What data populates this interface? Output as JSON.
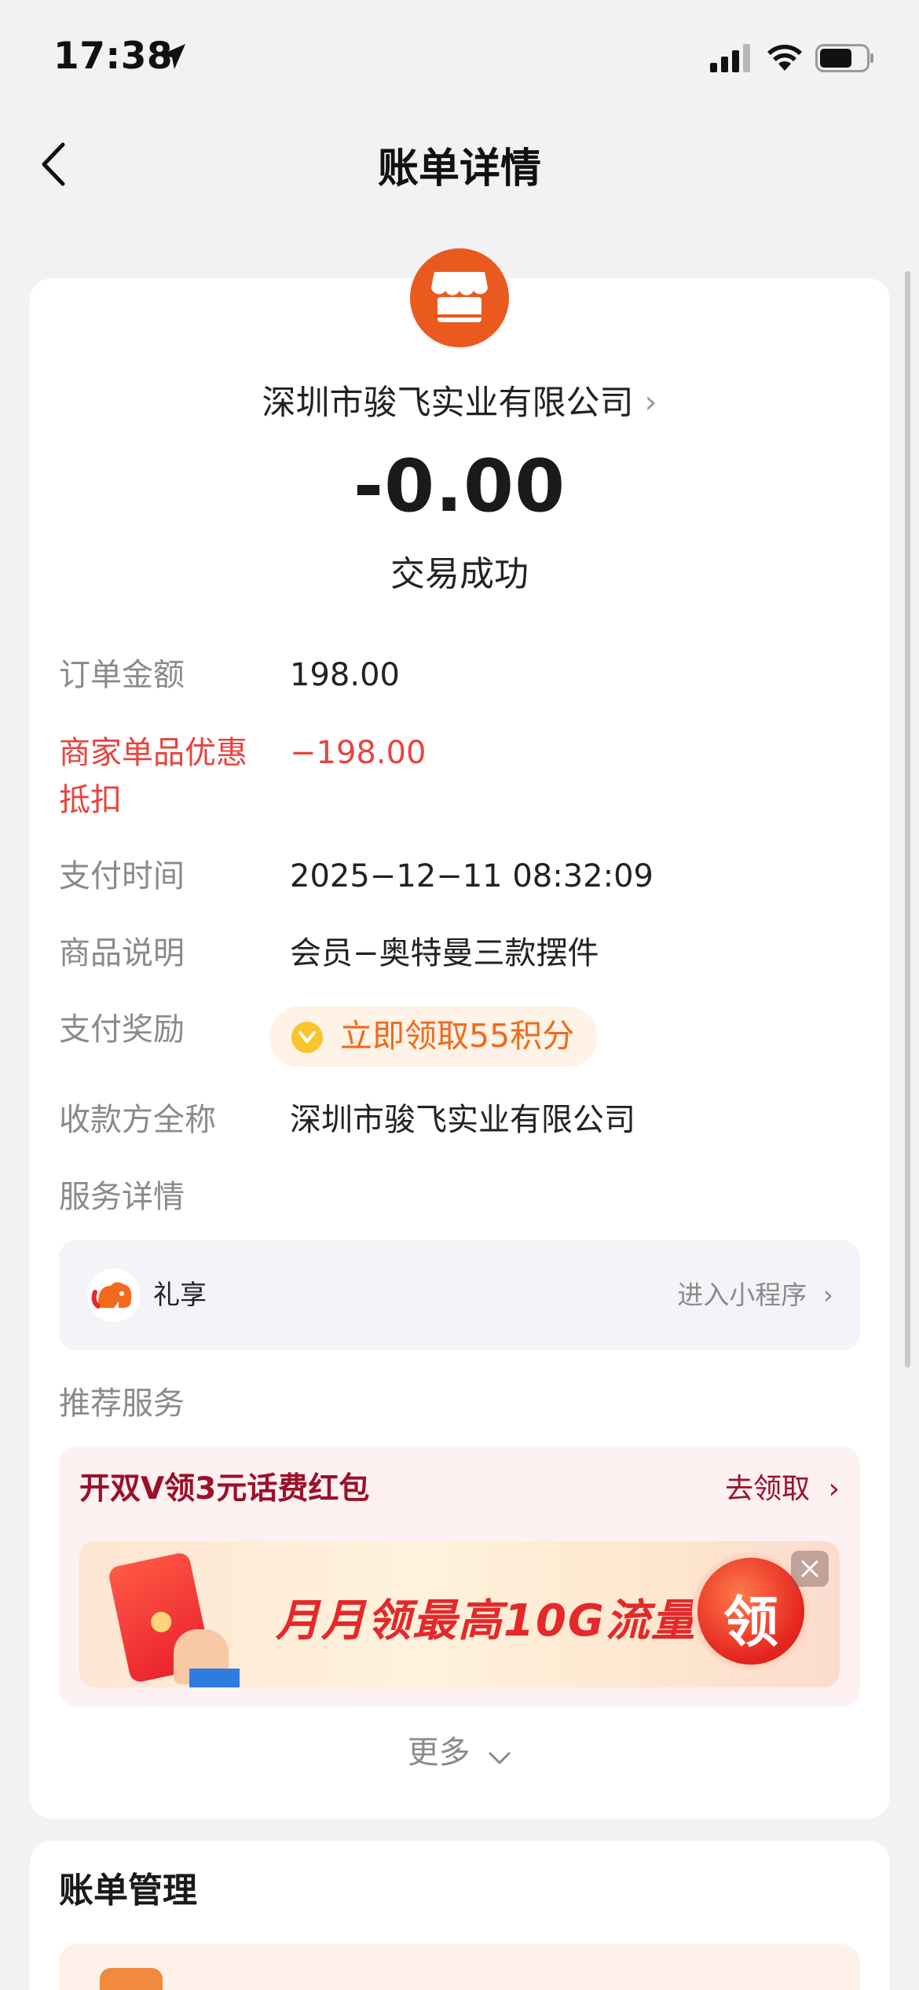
{
  "status_bar": {
    "time": "17:38"
  },
  "nav": {
    "title": "账单详情"
  },
  "header": {
    "merchant_name": "深圳市骏飞实业有限公司",
    "amount": "-0.00",
    "status": "交易成功"
  },
  "details": {
    "order_amount": {
      "label": "订单金额",
      "value": "198.00"
    },
    "discount": {
      "label_line1": "商家单品优惠",
      "label_line2": "抵扣",
      "value": "−198.00"
    },
    "pay_time": {
      "label": "支付时间",
      "value": "2025−12−11 08:32:09"
    },
    "product": {
      "label": "商品说明",
      "value": "会员−奥特曼三款摆件"
    },
    "reward": {
      "label": "支付奖励",
      "value": "立即领取55积分"
    },
    "payee": {
      "label": "收款方全称",
      "value": "深圳市骏飞实业有限公司"
    }
  },
  "service": {
    "section_label": "服务详情",
    "name": "礼享",
    "link": "进入小程序"
  },
  "recommend": {
    "section_label": "推荐服务",
    "title": "开双V领3元话费红包",
    "link": "去领取",
    "banner_text": "月月领最高10G流量",
    "banner_button": "领"
  },
  "more": {
    "label": "更多"
  },
  "bill_management": {
    "title": "账单管理"
  },
  "colors": {
    "accent_orange": "#ea5a1f",
    "discount_red": "#e8433f",
    "promo_red": "#9b1027",
    "page_bg": "#f2f2f4"
  }
}
